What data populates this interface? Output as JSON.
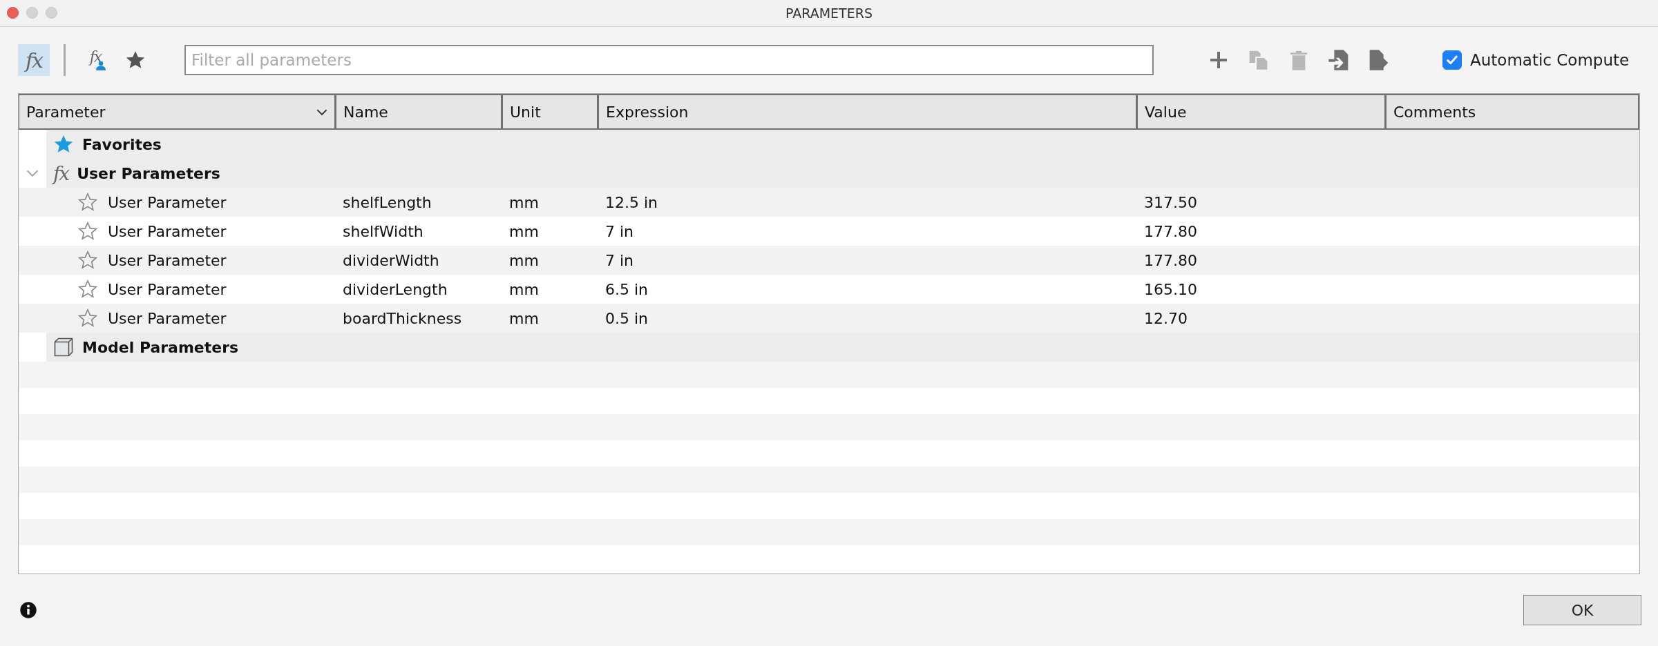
{
  "window": {
    "title": "PARAMETERS"
  },
  "toolbar": {
    "view_buttons": [
      {
        "kind": "all",
        "glyph": "fx",
        "selected": true
      },
      {
        "kind": "user",
        "glyph": "fx",
        "selected": false
      },
      {
        "kind": "favorites",
        "selected": false
      }
    ],
    "filter": {
      "placeholder": "Filter all parameters"
    },
    "actions": [
      {
        "kind": "add",
        "disabled": false
      },
      {
        "kind": "copy",
        "disabled": true
      },
      {
        "kind": "delete",
        "disabled": true
      },
      {
        "kind": "import",
        "disabled": false
      },
      {
        "kind": "export",
        "disabled": false
      }
    ],
    "automatic_compute": {
      "label": "Automatic Compute",
      "checked": true
    }
  },
  "table": {
    "columns": [
      "Parameter",
      "Name",
      "Unit",
      "Expression",
      "Value",
      "Comments"
    ],
    "groups": [
      {
        "kind": "favorites",
        "label": "Favorites"
      },
      {
        "kind": "user",
        "glyph": "fx",
        "label": "User Parameters",
        "expanded": true,
        "children": [
          {
            "parameter": "User Parameter",
            "name": "shelfLength",
            "unit": "mm",
            "expression": "12.5 in",
            "value": "317.50",
            "favorite": false
          },
          {
            "parameter": "User Parameter",
            "name": "shelfWidth",
            "unit": "mm",
            "expression": "7 in",
            "value": "177.80",
            "favorite": false
          },
          {
            "parameter": "User Parameter",
            "name": "dividerWidth",
            "unit": "mm",
            "expression": "7 in",
            "value": "177.80",
            "favorite": false
          },
          {
            "parameter": "User Parameter",
            "name": "dividerLength",
            "unit": "mm",
            "expression": "6.5 in",
            "value": "165.10",
            "favorite": false
          },
          {
            "parameter": "User Parameter",
            "name": "boardThickness",
            "unit": "mm",
            "expression": "0.5 in",
            "value": "12.70",
            "favorite": false
          }
        ]
      },
      {
        "kind": "model",
        "label": "Model Parameters"
      }
    ]
  },
  "footer": {
    "ok_button": "OK"
  }
}
